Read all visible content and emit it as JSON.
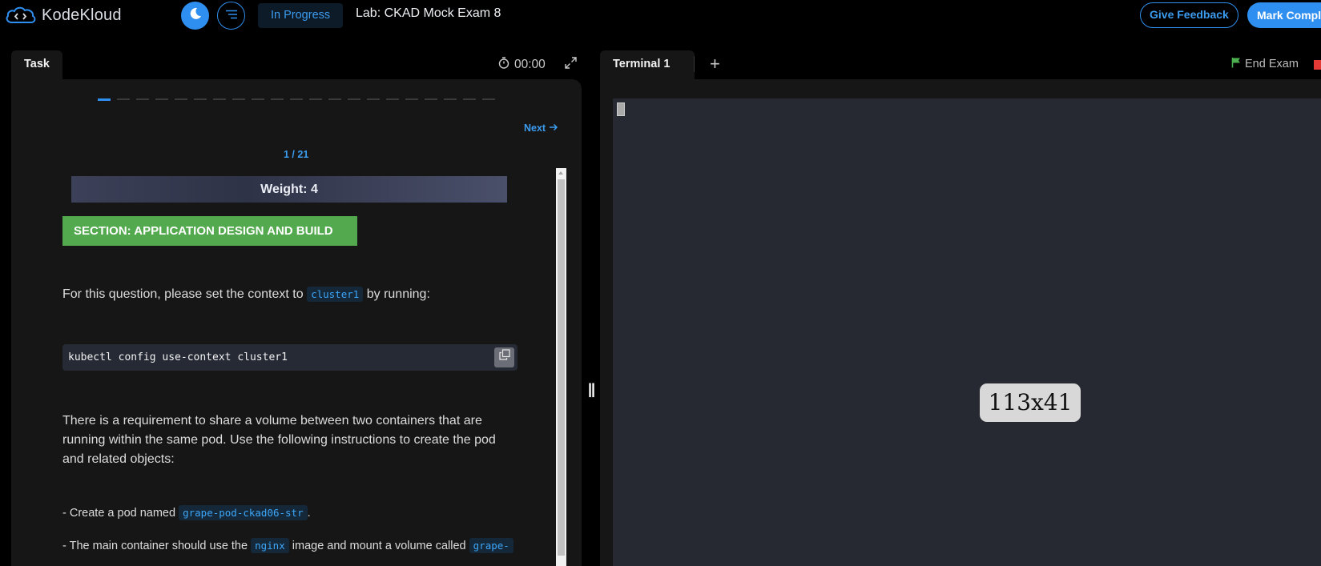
{
  "header": {
    "logo_text": "KodeKloud",
    "status": "In Progress",
    "lab_title": "Lab: CKAD Mock Exam 8",
    "feedback_label": "Give Feedback",
    "mark_complete_label": "Mark Compl"
  },
  "task_panel": {
    "tab_label": "Task",
    "timer": "00:00",
    "progress": {
      "total": 21,
      "current": 1
    },
    "next_label": "Next",
    "counter": "1 / 21",
    "weight": "Weight: 4",
    "section": "SECTION: APPLICATION DESIGN AND BUILD",
    "intro_before": "For this question, please set the context to ",
    "intro_code": "cluster1",
    "intro_after": " by running:",
    "command": "kubectl config use-context cluster1",
    "requirement": "There is a requirement to share a volume between two containers that are running within the same pod. Use the following instructions to create the pod and related objects:",
    "bullet1_before": "- Create a pod named ",
    "bullet1_code": "grape-pod-ckad06-str",
    "bullet1_after": ".",
    "bullet2_before": "- The main container should use the ",
    "bullet2_code1": "nginx",
    "bullet2_mid": " image and mount a volume called ",
    "bullet2_code2": "grape-"
  },
  "terminal_panel": {
    "tab_label": "Terminal 1",
    "add_tab": "+",
    "end_exam_label": "End Exam",
    "size_badge": "113x41"
  },
  "colors": {
    "accent": "#2f8ff0",
    "section_green": "#53a94d",
    "end_exam_flag": "#4caf50",
    "stop_red": "#e53935"
  }
}
